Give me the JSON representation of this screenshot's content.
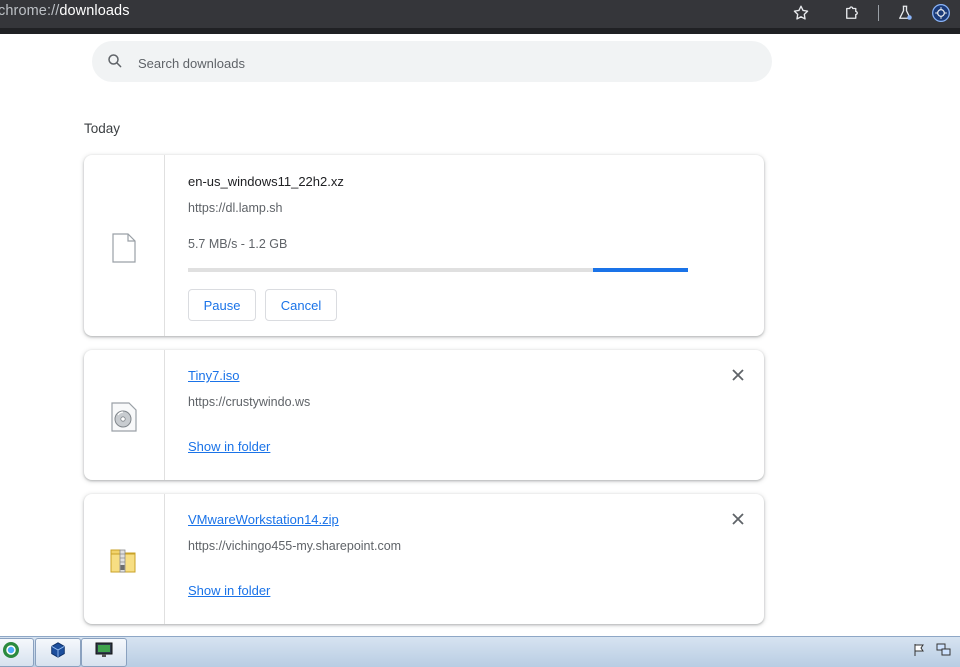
{
  "browser": {
    "url_scheme": "chrome://",
    "url_host": "downloads"
  },
  "icons": {
    "star": "star-icon",
    "extensions": "puzzle-icon",
    "labs": "flask-icon",
    "profile": "profile-icon"
  },
  "search": {
    "placeholder": "Search downloads"
  },
  "section": {
    "title": "Today"
  },
  "downloads": [
    {
      "file_name": "en-us_windows11_22h2.xz",
      "source": "https://dl.lamp.sh",
      "status": "5.7 MB/s - 1.2 GB",
      "progress_fraction_start": 0.81,
      "progress_fraction_end": 1.0,
      "pause_label": "Pause",
      "cancel_label": "Cancel",
      "icon": "document-icon"
    },
    {
      "file_name": "Tiny7.iso",
      "source": "https://crustywindo.ws",
      "show_in_folder": "Show in folder",
      "icon": "disc-image-icon"
    },
    {
      "file_name": "VMwareWorkstation14.zip",
      "source": "https://vichingo455-my.sharepoint.com",
      "show_in_folder": "Show in folder",
      "icon": "zip-folder-icon"
    }
  ],
  "colors": {
    "accent": "#1a73e8",
    "toolbar": "#35363a",
    "progress_track": "#e0e0e0"
  }
}
